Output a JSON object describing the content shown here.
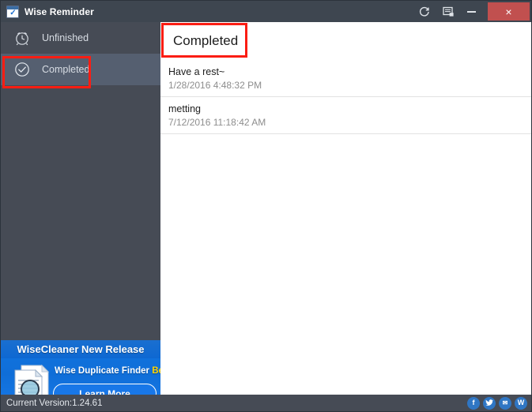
{
  "window": {
    "title": "Wise Reminder",
    "app_icon": "calendar-check-icon",
    "controls": {
      "refresh_icon": "refresh-icon",
      "feedback_icon": "feedback-icon",
      "minimize_label": "Minimize",
      "close_label": "×"
    }
  },
  "sidebar": {
    "items": [
      {
        "label": "Unfinished",
        "icon": "alarm-clock-icon",
        "active": false
      },
      {
        "label": "Completed",
        "icon": "check-circle-icon",
        "active": true
      }
    ],
    "promo": {
      "header": "WiseCleaner New Release",
      "product": "Wise Duplicate Finder",
      "badge": "Beta",
      "button": "Learn More",
      "art_icon": "document-magnifier-icon"
    }
  },
  "content": {
    "header": "Completed",
    "tasks": [
      {
        "title": "Have a rest~",
        "date": "1/28/2016 4:48:32 PM"
      },
      {
        "title": "metting",
        "date": "7/12/2016 11:18:42 AM"
      }
    ]
  },
  "statusbar": {
    "version": "Current Version:1.24.61",
    "social": [
      {
        "name": "facebook-icon",
        "glyph": "f"
      },
      {
        "name": "twitter-icon",
        "glyph": "ᴠ"
      },
      {
        "name": "email-icon",
        "glyph": "✉"
      },
      {
        "name": "wisecleaner-icon",
        "glyph": "W"
      }
    ]
  },
  "annotations": {
    "sidebar_highlight": "completed-nav-highlight",
    "header_highlight": "completed-header-highlight"
  },
  "colors": {
    "titlebar": "#3e4650",
    "sidebar": "#464b55",
    "sidebar_active": "#555f70",
    "close_red": "#c1504f",
    "promo_blue": "#1275e0",
    "annotation_red": "#fb1d13",
    "beta_yellow": "#ffd400"
  }
}
